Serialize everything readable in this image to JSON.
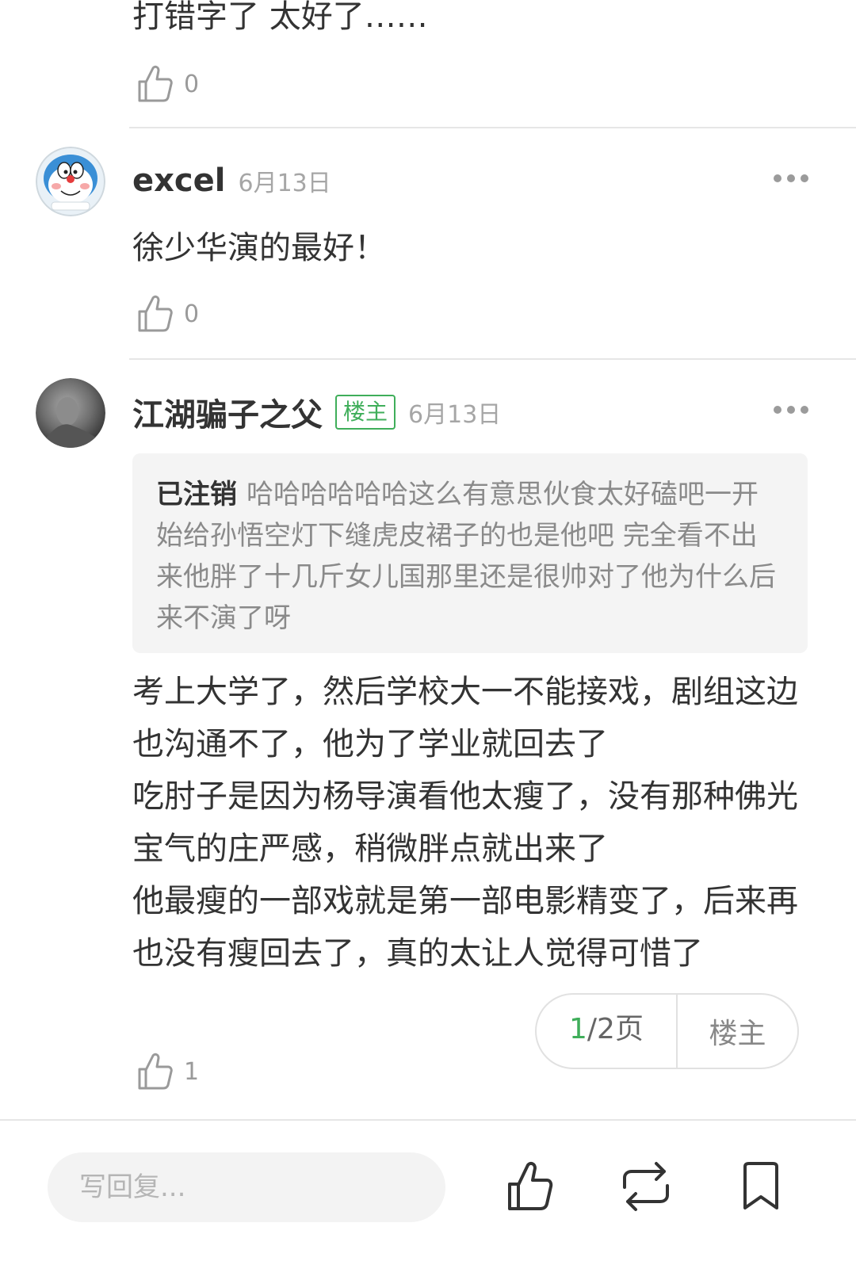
{
  "comments": [
    {
      "body": "打错字了  太好了……",
      "like_count": "0"
    },
    {
      "username": "excel",
      "date": "6月13日",
      "body": "徐少华演的最好！",
      "like_count": "0"
    },
    {
      "username": "江湖骗子之父",
      "badge": "楼主",
      "date": "6月13日",
      "quote": {
        "author": "已注销",
        "text": "哈哈哈哈哈哈这么有意思伙食太好磕吧一开始给孙悟空灯下缝虎皮裙子的也是他吧   完全看不出来他胖了十几斤女儿国那里还是很帅对了他为什么后来不演了呀"
      },
      "body": "考上大学了，然后学校大一不能接戏，剧组这边也沟通不了，他为了学业就回去了\n吃肘子是因为杨导演看他太瘦了，没有那种佛光宝气的庄严感，稍微胖点就出来了\n他最瘦的一部戏就是第一部电影精变了，后来再也没有瘦回去了，真的太让人觉得可惜了",
      "like_count": "1"
    }
  ],
  "pager": {
    "current": "1",
    "total": "/2页",
    "owner_only": "楼主"
  },
  "bottom_bar": {
    "reply_placeholder": "写回复...",
    "icons": [
      "like-icon",
      "repost-icon",
      "bookmark-icon"
    ]
  },
  "colors": {
    "accent_green": "#3fae5a",
    "text": "#333333",
    "muted": "#9a9a9a"
  }
}
